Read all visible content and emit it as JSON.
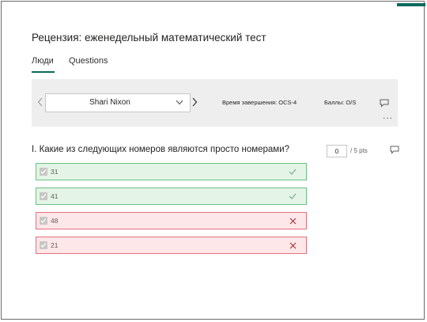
{
  "page": {
    "title": "Рецензия: еженедельный математический тест"
  },
  "tabs": [
    {
      "label": "Люди",
      "selected": true
    },
    {
      "label": "Questions",
      "selected": false
    }
  ],
  "respondent_bar": {
    "selected_person": "Shari Nixon",
    "completion_time": "Время завершения: OCS-4",
    "points": "Баллы: O/S",
    "more_label": "..."
  },
  "question": {
    "text": "I. Какие из следующих номеров являются просто номерами?",
    "score_value": "0",
    "score_max": "/ 5 pts",
    "options": [
      {
        "label": "31",
        "checked": true,
        "result": "correct"
      },
      {
        "label": "41",
        "checked": true,
        "result": "correct"
      },
      {
        "label": "48",
        "checked": true,
        "result": "incorrect"
      },
      {
        "label": "21",
        "checked": true,
        "result": "incorrect"
      }
    ]
  },
  "colors": {
    "accent": "#0b6a5d",
    "correct_fill": "#e4f4e6",
    "correct_border": "#6cc084",
    "incorrect_fill": "#fde7e9",
    "incorrect_border": "#e4707d"
  },
  "icons": {
    "prev": "chevron-left-icon",
    "next": "chevron-right-icon",
    "dropdown": "chevron-down-icon",
    "comment": "comment-icon",
    "more": "more-horizontal-icon",
    "correct": "checkmark-icon",
    "incorrect": "x-icon"
  }
}
